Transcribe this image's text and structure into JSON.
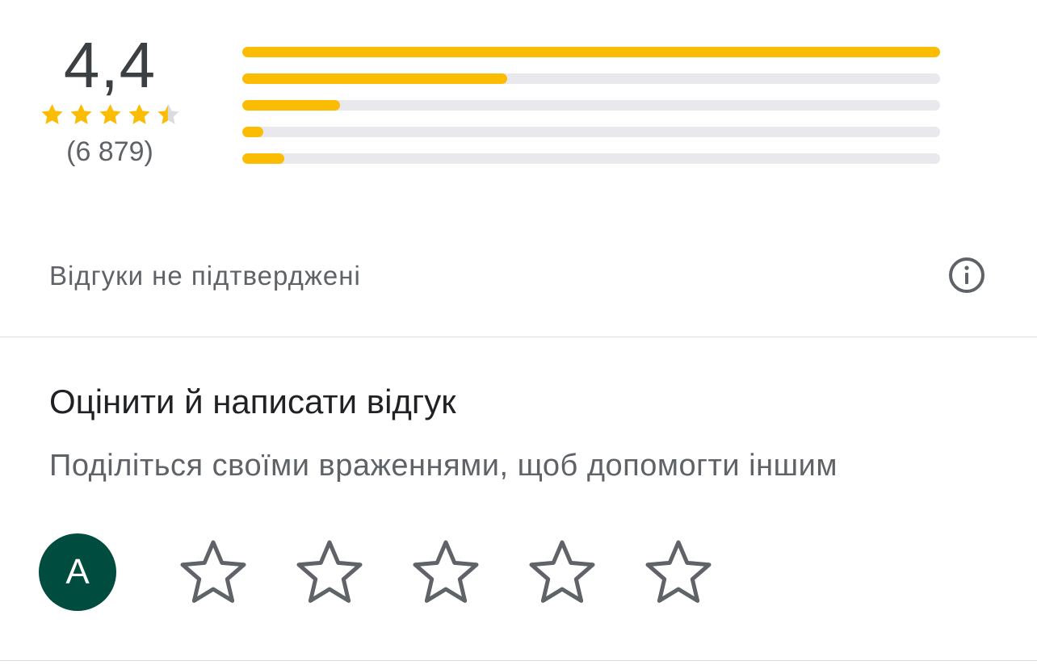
{
  "summary": {
    "score": "4,4",
    "stars_value": 4.4,
    "count": "(6 879)",
    "distribution": [
      1.0,
      0.38,
      0.14,
      0.03,
      0.06
    ],
    "colors": {
      "filled": "#fbbc04",
      "track": "#e8e8ed"
    }
  },
  "notice": {
    "text": "Відгуки не підтверджені",
    "icon": "info-icon"
  },
  "rate": {
    "title": "Оцінити й написати відгук",
    "subtitle": "Поділіться своїми враженнями, щоб допомогти іншим",
    "avatar_letter": "A",
    "avatar_color": "#004d40",
    "star_count": 5
  }
}
